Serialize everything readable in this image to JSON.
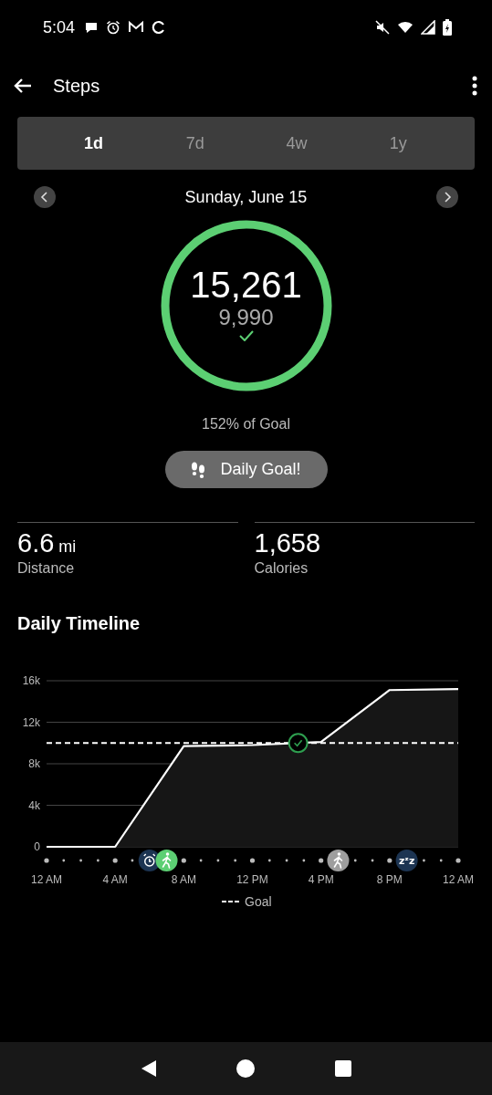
{
  "status_bar": {
    "time": "5:04"
  },
  "app_bar": {
    "title": "Steps"
  },
  "tabs": [
    {
      "label": "1d",
      "selected": true
    },
    {
      "label": "7d",
      "selected": false
    },
    {
      "label": "4w",
      "selected": false
    },
    {
      "label": "1y",
      "selected": false
    }
  ],
  "date": "Sunday, June 15",
  "ring": {
    "steps": "15,261",
    "goal": "9,990",
    "goal_met": true
  },
  "percent_of_goal": "152% of Goal",
  "goal_badge": "Daily Goal!",
  "stats": [
    {
      "value": "6.6",
      "unit": "mi",
      "label": "Distance"
    },
    {
      "value": "1,658",
      "label": "Calories"
    }
  ],
  "timeline": {
    "title": "Daily Timeline",
    "goal_reached": true,
    "chart_data": {
      "type": "area",
      "grid": true,
      "categories": [
        "12 AM",
        "4 AM",
        "8 AM",
        "12 PM",
        "4 PM",
        "8 PM",
        "12 AM"
      ],
      "series": [
        {
          "color": "#ffffff",
          "values": [
            0,
            0,
            9700,
            9800,
            10100,
            15100,
            15200
          ]
        }
      ],
      "ylim": [
        0,
        16000
      ],
      "yticks": [
        {
          "value": 0,
          "label": "0"
        },
        {
          "value": 4000,
          "label": "4k"
        },
        {
          "value": 8000,
          "label": "8k"
        },
        {
          "value": 12000,
          "label": "12k"
        },
        {
          "value": 16000,
          "label": "16k"
        }
      ],
      "ref_lines": [
        {
          "axis": "y",
          "value": 10000,
          "label": "Goal",
          "color": "#ffffff"
        }
      ]
    },
    "markers": [
      {
        "kind": "major"
      },
      {
        "kind": "minor"
      },
      {
        "kind": "minor"
      },
      {
        "kind": "minor"
      },
      {
        "kind": "major"
      },
      {
        "kind": "minor"
      },
      {
        "kind": "alarm",
        "color": "#1c3452"
      },
      {
        "kind": "walk",
        "color": "#5ccf73"
      },
      {
        "kind": "major"
      },
      {
        "kind": "minor"
      },
      {
        "kind": "minor"
      },
      {
        "kind": "minor"
      },
      {
        "kind": "major"
      },
      {
        "kind": "minor"
      },
      {
        "kind": "minor"
      },
      {
        "kind": "minor"
      },
      {
        "kind": "major"
      },
      {
        "kind": "walk",
        "color": "#9e9e9e"
      },
      {
        "kind": "minor"
      },
      {
        "kind": "minor"
      },
      {
        "kind": "major"
      },
      {
        "kind": "sleep",
        "color": "#1c3452",
        "glyph": "zᶻz"
      },
      {
        "kind": "minor"
      },
      {
        "kind": "minor"
      },
      {
        "kind": "major"
      }
    ]
  }
}
